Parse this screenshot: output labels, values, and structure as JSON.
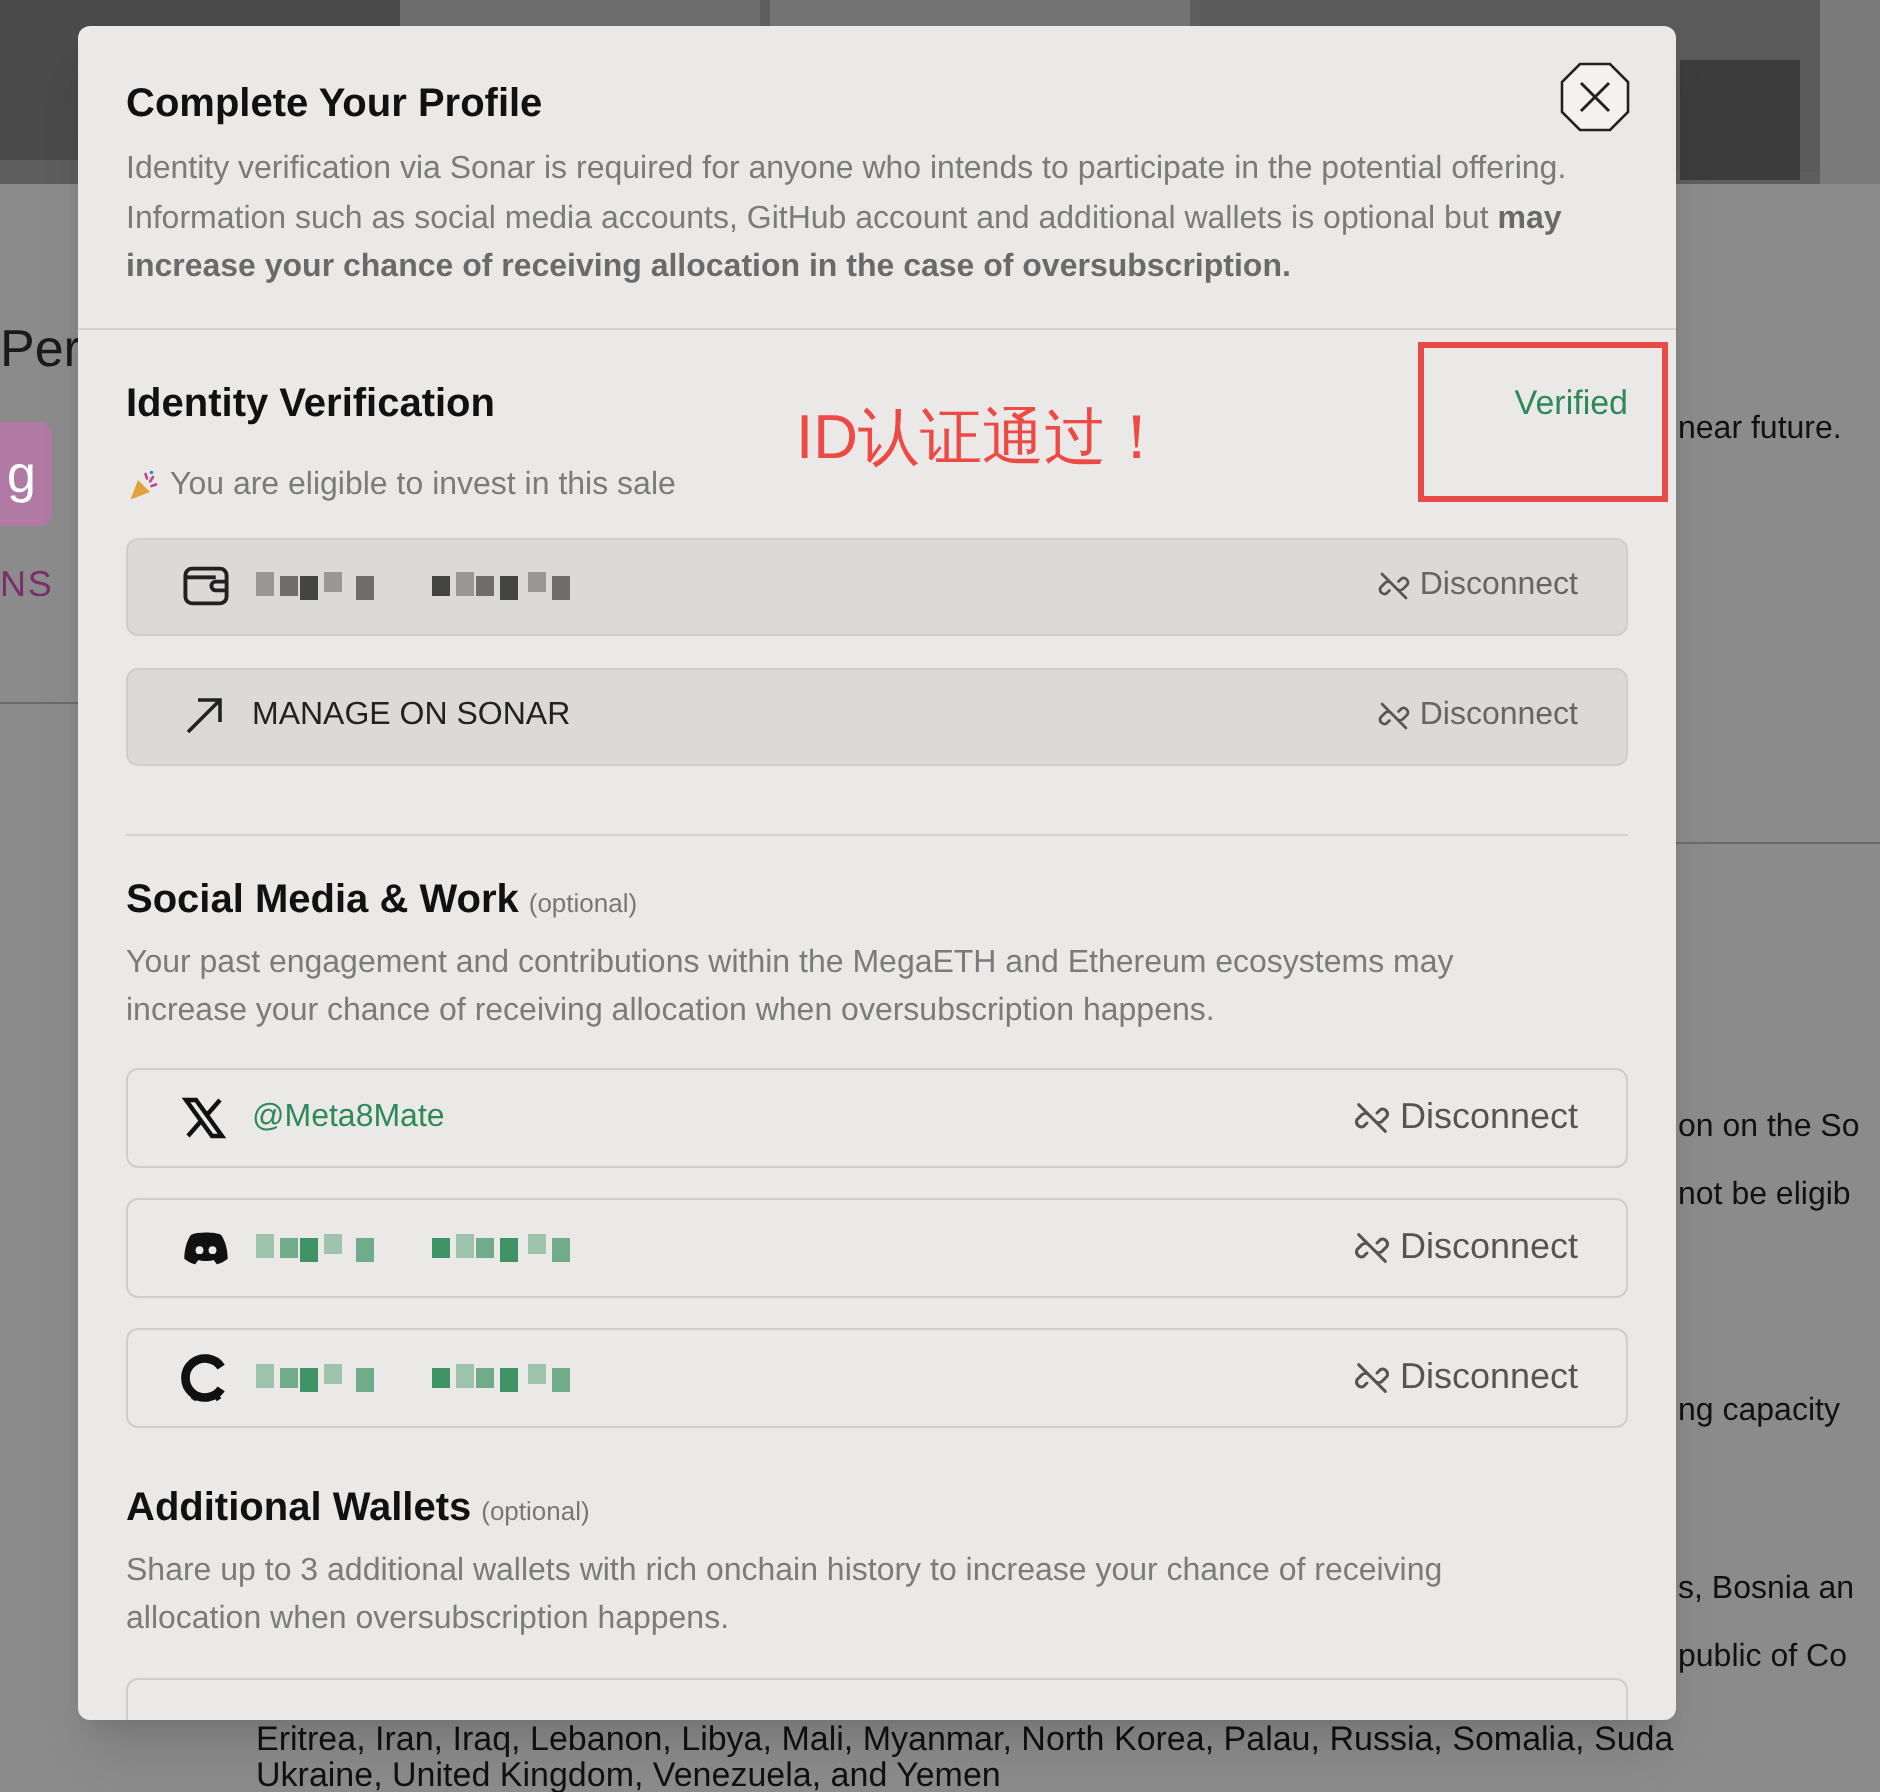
{
  "background_page": {
    "heading_fragment": "Per",
    "badge": "g",
    "badge_caption": "NS",
    "text_fragments": [
      "near future.",
      "on on the So",
      "not be eligib",
      "ng capacity",
      "s, Bosnia an",
      "public of Co"
    ],
    "paragraph_lines": [
      "Eritrea, Iran, Iraq, Lebanon, Libya, Mali, Myanmar, North Korea, Palau, Russia, Somalia, Suda",
      "Ukraine, United Kingdom, Venezuela, and Yemen"
    ]
  },
  "modal": {
    "title": "Complete Your Profile",
    "description": "Identity verification via Sonar is required for anyone who intends to participate in the potential offering. Information such as social media accounts, GitHub account and additional wallets is optional but **may increase your chance of receiving allocation in the case of oversubscription.**",
    "identity": {
      "title": "Identity Verification",
      "status": "Verified",
      "note": "You are eligible to invest in this sale",
      "rows": [
        {
          "kind": "wallet",
          "action": "Disconnect"
        },
        {
          "kind": "link",
          "label": "MANAGE ON SONAR",
          "action": "Disconnect"
        }
      ]
    },
    "social": {
      "title": "Social Media & Work",
      "tag": "(optional)",
      "description": "Your past engagement and contributions within the MegaETH and Ethereum ecosystems may increase your chance of receiving allocation when oversubscription happens.",
      "accounts": [
        {
          "kind": "x",
          "handle": "@Meta8Mate",
          "action": "Disconnect"
        },
        {
          "kind": "discord",
          "action": "Disconnect"
        },
        {
          "kind": "ring",
          "action": "Disconnect"
        }
      ]
    },
    "wallets": {
      "title": "Additional Wallets",
      "tag": "(optional)",
      "description": "Share up to 3 additional wallets with rich onchain history to increase your chance of receiving allocation when oversubscription happens."
    }
  },
  "annotation": {
    "text": "ID认证通过！"
  }
}
